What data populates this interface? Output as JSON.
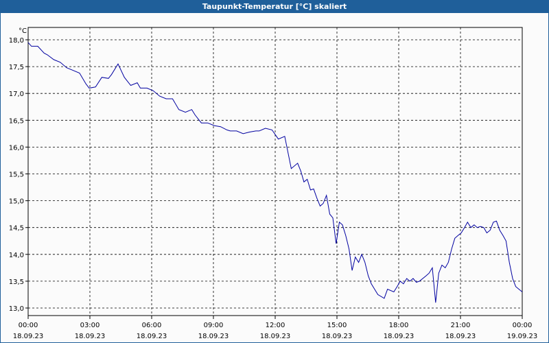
{
  "window": {
    "title": "Taupunkt-Temperatur [°C] skaliert"
  },
  "chart_data": {
    "type": "line",
    "title": "Taupunkt-Temperatur [°C] skaliert",
    "ylabel": "°C",
    "xlabel": "",
    "ylim": [
      12.9,
      18.0
    ],
    "xlim": [
      0,
      24
    ],
    "grid": true,
    "legend": "none",
    "line_color": "#0000a0",
    "y_ticks": [
      "18,0",
      "17,5",
      "17,0",
      "16,5",
      "16,0",
      "15,5",
      "15,0",
      "14,5",
      "14,0",
      "13,5",
      "13,0"
    ],
    "x_ticks": [
      {
        "time": "00:00",
        "date": "18.09.23"
      },
      {
        "time": "03:00",
        "date": "18.09.23"
      },
      {
        "time": "06:00",
        "date": "18.09.23"
      },
      {
        "time": "09:00",
        "date": "18.09.23"
      },
      {
        "time": "12:00",
        "date": "18.09.23"
      },
      {
        "time": "15:00",
        "date": "18.09.23"
      },
      {
        "time": "18:00",
        "date": "18.09.23"
      },
      {
        "time": "21:00",
        "date": "18.09.23"
      },
      {
        "time": "00:00",
        "date": "19.09.23"
      }
    ],
    "series": [
      {
        "values": [
          [
            0.0,
            17.95
          ],
          [
            0.17,
            17.88
          ],
          [
            0.5,
            17.88
          ],
          [
            0.83,
            17.75
          ],
          [
            1.0,
            17.72
          ],
          [
            1.33,
            17.63
          ],
          [
            1.67,
            17.58
          ],
          [
            2.0,
            17.48
          ],
          [
            2.33,
            17.43
          ],
          [
            2.67,
            17.38
          ],
          [
            3.0,
            17.18
          ],
          [
            3.17,
            17.1
          ],
          [
            3.5,
            17.12
          ],
          [
            3.83,
            17.3
          ],
          [
            4.17,
            17.28
          ],
          [
            4.33,
            17.35
          ],
          [
            4.67,
            17.55
          ],
          [
            5.0,
            17.3
          ],
          [
            5.33,
            17.15
          ],
          [
            5.67,
            17.2
          ],
          [
            5.83,
            17.1
          ],
          [
            6.17,
            17.1
          ],
          [
            6.5,
            17.05
          ],
          [
            6.83,
            16.95
          ],
          [
            7.17,
            16.9
          ],
          [
            7.5,
            16.9
          ],
          [
            7.83,
            16.7
          ],
          [
            8.17,
            16.65
          ],
          [
            8.5,
            16.7
          ],
          [
            8.67,
            16.6
          ],
          [
            9.0,
            16.45
          ],
          [
            9.33,
            16.45
          ],
          [
            9.67,
            16.4
          ],
          [
            10.0,
            16.38
          ],
          [
            10.33,
            16.32
          ],
          [
            10.5,
            16.3
          ],
          [
            10.83,
            16.3
          ],
          [
            11.17,
            16.25
          ],
          [
            11.5,
            16.28
          ],
          [
            11.83,
            16.3
          ],
          [
            12.0,
            16.3
          ],
          [
            12.33,
            16.35
          ],
          [
            12.67,
            16.32
          ],
          [
            13.0,
            16.15
          ],
          [
            13.33,
            16.2
          ],
          [
            13.67,
            15.6
          ],
          [
            14.0,
            15.7
          ],
          [
            14.17,
            15.55
          ],
          [
            14.33,
            15.35
          ],
          [
            14.5,
            15.4
          ],
          [
            14.67,
            15.2
          ],
          [
            14.83,
            15.22
          ],
          [
            15.0,
            15.05
          ],
          [
            15.17,
            14.9
          ],
          [
            15.33,
            14.95
          ],
          [
            15.5,
            15.1
          ],
          [
            15.67,
            14.75
          ],
          [
            15.83,
            14.68
          ],
          [
            16.0,
            14.2
          ],
          [
            16.17,
            14.6
          ],
          [
            16.33,
            14.55
          ],
          [
            16.5,
            14.35
          ],
          [
            16.67,
            14.1
          ],
          [
            16.83,
            13.7
          ],
          [
            17.0,
            13.95
          ],
          [
            17.17,
            13.85
          ],
          [
            17.33,
            14.0
          ],
          [
            17.5,
            13.85
          ],
          [
            17.67,
            13.6
          ],
          [
            17.83,
            13.45
          ],
          [
            18.17,
            13.25
          ],
          [
            18.5,
            13.18
          ],
          [
            18.67,
            13.35
          ],
          [
            19.0,
            13.3
          ],
          [
            19.17,
            13.4
          ],
          [
            19.33,
            13.5
          ],
          [
            19.5,
            13.45
          ],
          [
            19.67,
            13.55
          ],
          [
            19.83,
            13.5
          ],
          [
            20.0,
            13.55
          ],
          [
            20.17,
            13.48
          ],
          [
            20.33,
            13.5
          ],
          [
            20.67,
            13.6
          ],
          [
            20.83,
            13.65
          ],
          [
            21.0,
            13.75
          ],
          [
            21.17,
            13.1
          ],
          [
            21.33,
            13.65
          ],
          [
            21.5,
            13.8
          ],
          [
            21.67,
            13.75
          ],
          [
            21.83,
            13.85
          ],
          [
            22.0,
            14.1
          ],
          [
            22.17,
            14.3
          ],
          [
            22.33,
            14.35
          ],
          [
            22.5,
            14.4
          ],
          [
            22.67,
            14.5
          ],
          [
            22.83,
            14.6
          ],
          [
            23.0,
            14.5
          ],
          [
            23.17,
            14.55
          ],
          [
            23.33,
            14.5
          ],
          [
            23.5,
            14.52
          ],
          [
            23.67,
            14.5
          ],
          [
            23.83,
            14.4
          ],
          [
            24.0,
            14.45
          ],
          [
            24.17,
            14.6
          ],
          [
            24.33,
            14.62
          ],
          [
            24.5,
            14.45
          ],
          [
            24.67,
            14.35
          ],
          [
            24.83,
            14.25
          ],
          [
            25.0,
            13.85
          ],
          [
            25.17,
            13.55
          ],
          [
            25.33,
            13.4
          ],
          [
            25.5,
            13.35
          ],
          [
            25.67,
            13.3
          ]
        ]
      }
    ]
  }
}
